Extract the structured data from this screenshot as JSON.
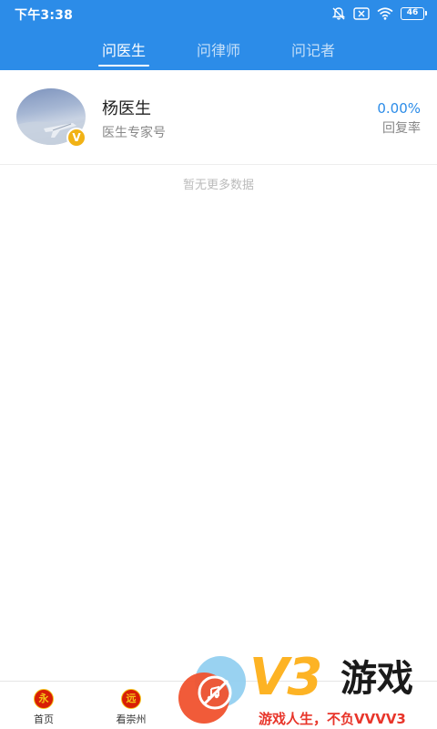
{
  "status_bar": {
    "time": "下午3:38",
    "battery": "46",
    "icons": [
      "alarm-off-icon",
      "sim-x-icon",
      "wifi-icon",
      "battery-icon"
    ]
  },
  "tabs": [
    {
      "label": "问医生",
      "active": true
    },
    {
      "label": "问律师",
      "active": false
    },
    {
      "label": "问记者",
      "active": false
    }
  ],
  "colors": {
    "accent": "#2c8ce8",
    "badge": "#f1b215",
    "nav_icon_red": "#d81e06",
    "nav_icon_gold": "#f5c518"
  },
  "list": {
    "items": [
      {
        "name": "杨医生",
        "subtitle": "医生专家号",
        "reply_rate": "0.00%",
        "reply_rate_label": "回复率",
        "badge": "V",
        "avatar": "sky-photo"
      }
    ],
    "empty_hint": "暂无更多数据"
  },
  "bottom_nav": [
    {
      "label": "首页",
      "icon_text": "永",
      "icon": "home-icon"
    },
    {
      "label": "看崇州",
      "icon_text": "远",
      "icon": "city-icon"
    }
  ],
  "watermark": {
    "brand": "V3",
    "brand_suffix": "游戏",
    "slogan": "游戏人生，不负VVVV3"
  }
}
